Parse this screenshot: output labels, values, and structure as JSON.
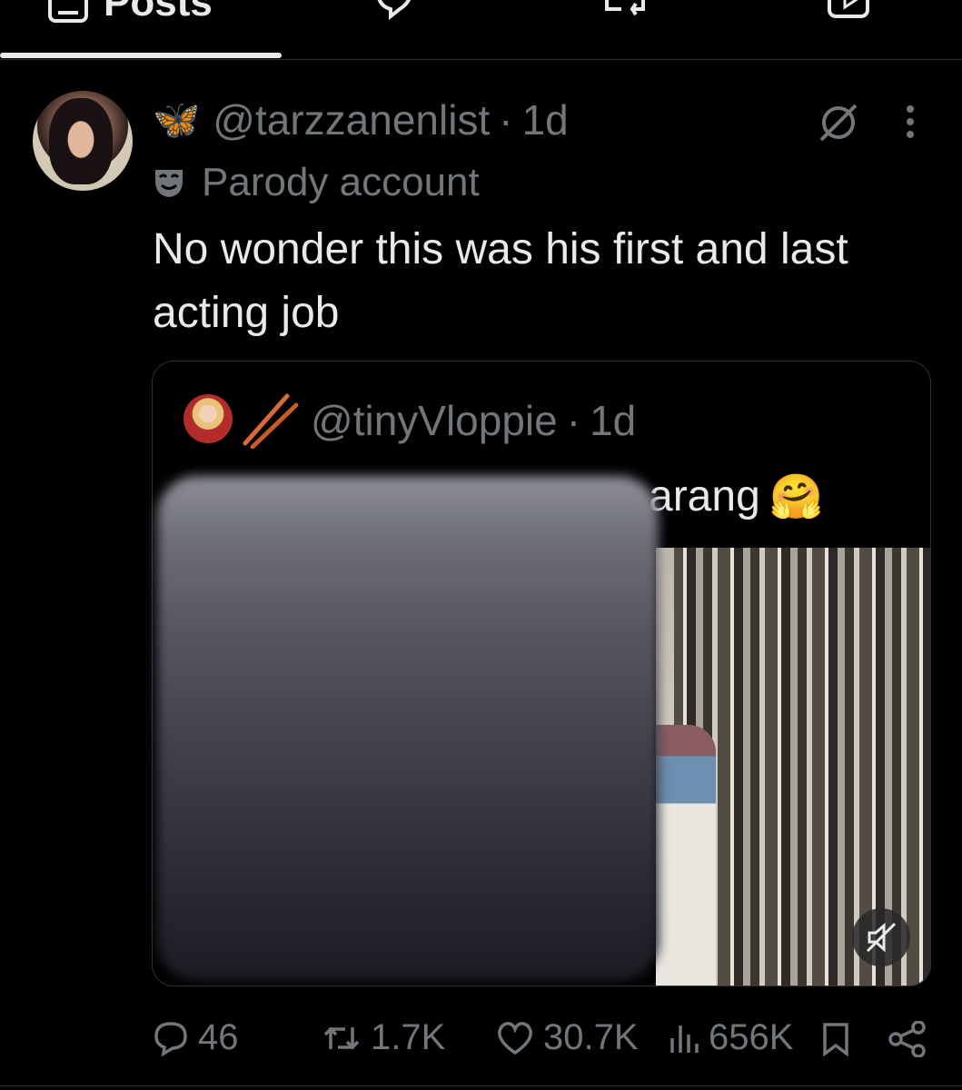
{
  "tabs": {
    "posts_label": "Posts"
  },
  "post": {
    "author_emoji": "🦋",
    "handle": "@tarzzanenlist",
    "separator": "·",
    "time": "1d",
    "label": "Parody account",
    "text": "No wonder this was his first and last acting job",
    "icons": [
      "grok-icon",
      "more-icon",
      "parody-mask-icon"
    ]
  },
  "quote": {
    "handle": "@tinyVloppie",
    "separator": "·",
    "time": "1d",
    "text_visible": "arang",
    "emoji": "🤗",
    "media_state": "muted"
  },
  "actions": {
    "replies": "46",
    "reposts": "1.7K",
    "likes": "30.7K",
    "views": "656K"
  },
  "colors": {
    "background": "#000000",
    "text_primary": "#e7e9ea",
    "text_secondary": "#71767b",
    "border": "#2f3336"
  }
}
